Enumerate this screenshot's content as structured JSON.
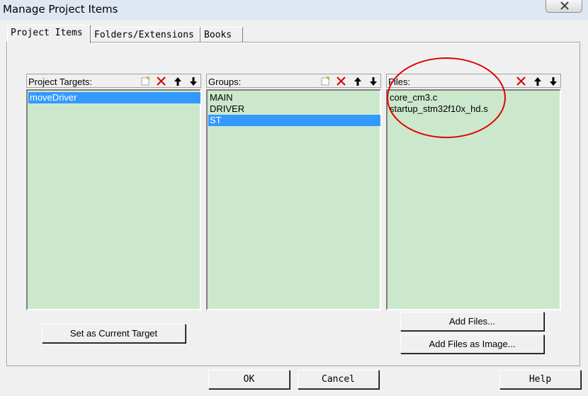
{
  "window": {
    "title": "Manage Project Items"
  },
  "tabs": [
    {
      "label": "Project Items",
      "active": true
    },
    {
      "label": "Folders/Extensions",
      "active": false
    },
    {
      "label": "Books",
      "active": false
    }
  ],
  "targets": {
    "header": "Project Targets:",
    "items": [
      "moveDriver"
    ],
    "selected_index": 0
  },
  "groups": {
    "header": "Groups:",
    "items": [
      "MAIN",
      "DRIVER",
      "ST"
    ],
    "selected_index": 2
  },
  "files": {
    "header": "Files:",
    "items": [
      "core_cm3.c",
      "startup_stm32f10x_hd.s"
    ]
  },
  "buttons": {
    "set_current_target": "Set as Current Target",
    "add_files": "Add Files...",
    "add_files_as_image": "Add Files as Image...",
    "ok": "OK",
    "cancel": "Cancel",
    "help": "Help"
  },
  "colors": {
    "list_bg": "#cce8cc",
    "selection": "#3399ff",
    "annotation": "#e00000"
  },
  "icons": {
    "new": "new-item-icon",
    "delete": "delete-icon",
    "up": "move-up-icon",
    "down": "move-down-icon",
    "close": "close-icon"
  }
}
